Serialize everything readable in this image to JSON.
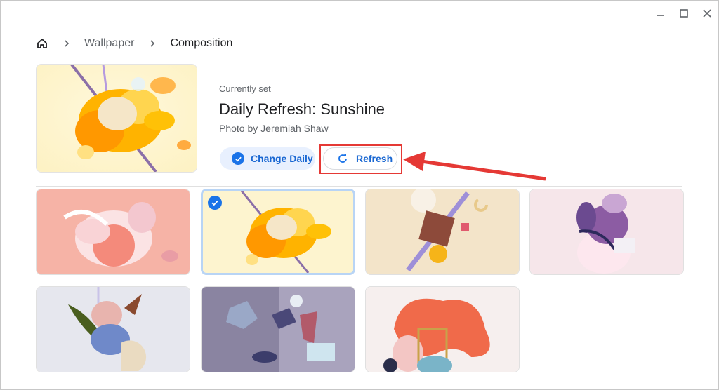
{
  "window": {
    "controls": [
      "minimize-icon",
      "maximize-icon",
      "close-icon"
    ]
  },
  "breadcrumb": {
    "home_icon": "home-icon",
    "separator_icon": "chevron-right-icon",
    "items": [
      {
        "label": "Wallpaper"
      },
      {
        "label": "Composition"
      }
    ]
  },
  "current": {
    "label": "Currently set",
    "title": "Daily Refresh: Sunshine",
    "credit": "Photo by Jeremiah Shaw"
  },
  "actions": {
    "change_daily": {
      "label": "Change Daily",
      "icon": "check-circle-icon",
      "active": true
    },
    "refresh": {
      "label": "Refresh",
      "icon": "refresh-icon"
    }
  },
  "annotation": {
    "color": "#e53935"
  },
  "colors": {
    "accent": "#1a73e8",
    "accent_text": "#1967d2",
    "chip_bg": "#e8f0fe",
    "selected_border": "#b8d4f5"
  },
  "wallpapers": [
    {
      "name": "pink-composition",
      "selected": false
    },
    {
      "name": "sunshine-composition",
      "selected": true
    },
    {
      "name": "cube-composition",
      "selected": false
    },
    {
      "name": "lavender-composition",
      "selected": false
    },
    {
      "name": "leaf-composition",
      "selected": false
    },
    {
      "name": "glass-composition",
      "selected": false
    },
    {
      "name": "blob-composition",
      "selected": false
    }
  ]
}
